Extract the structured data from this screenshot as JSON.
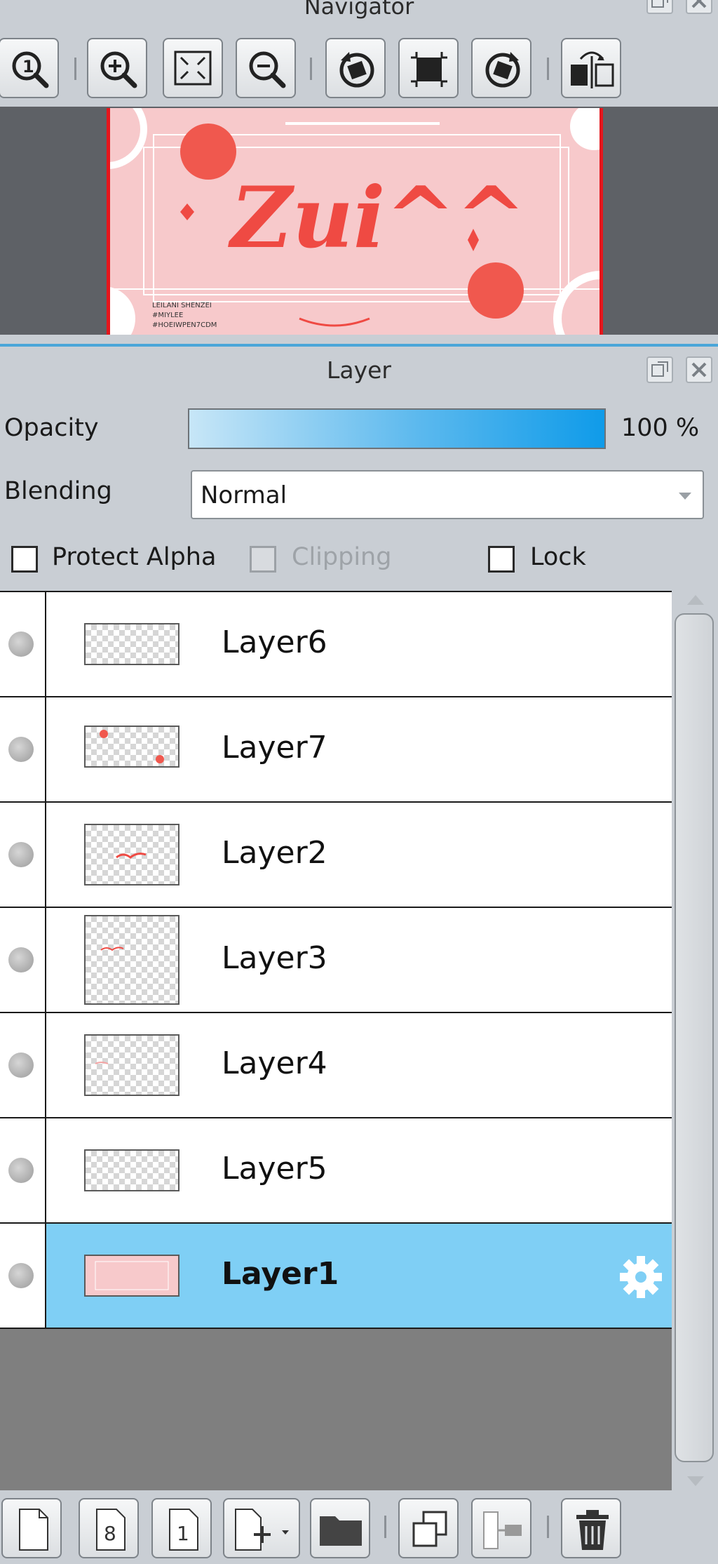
{
  "navigator": {
    "title": "Navigator",
    "toolbar": [
      {
        "name": "zoom-actual-icon"
      },
      {
        "name": "zoom-in-icon"
      },
      {
        "name": "fit-to-window-icon"
      },
      {
        "name": "zoom-out-icon"
      },
      {
        "name": "rotate-left-icon"
      },
      {
        "name": "reset-view-icon"
      },
      {
        "name": "rotate-right-icon"
      },
      {
        "name": "flip-horizontal-icon"
      }
    ],
    "preview_text": "Zui^^",
    "preview_caption": [
      "LEILANI SHENZEI",
      "#MIYLEE",
      "#HOEIWPEN7CDM"
    ]
  },
  "layer_panel": {
    "title": "Layer",
    "opacity_label": "Opacity",
    "opacity_value": "100 %",
    "opacity": 1.0,
    "blending_label": "Blending",
    "blending_value": "Normal",
    "protect_alpha_label": "Protect Alpha",
    "clipping_label": "Clipping",
    "lock_label": "Lock",
    "layers": [
      {
        "name": "Layer6",
        "selected": false
      },
      {
        "name": "Layer7",
        "selected": false
      },
      {
        "name": "Layer2",
        "selected": false
      },
      {
        "name": "Layer3",
        "selected": false
      },
      {
        "name": "Layer4",
        "selected": false
      },
      {
        "name": "Layer5",
        "selected": false
      },
      {
        "name": "Layer1",
        "selected": true
      }
    ]
  },
  "bottom_toolbar": [
    {
      "name": "new-layer-icon"
    },
    {
      "name": "new-8bit-layer-icon",
      "label": "8"
    },
    {
      "name": "new-1bit-layer-icon",
      "label": "1"
    },
    {
      "name": "add-layer-menu-icon"
    },
    {
      "name": "new-folder-icon"
    },
    {
      "name": "duplicate-layer-icon"
    },
    {
      "name": "merge-down-icon"
    },
    {
      "name": "delete-layer-icon"
    }
  ],
  "colors": {
    "panel_bg": "#c9ced4",
    "selected_row": "#7fcff5",
    "accent_red": "#e4161c",
    "thumb_pink": "#f7c9cb"
  }
}
